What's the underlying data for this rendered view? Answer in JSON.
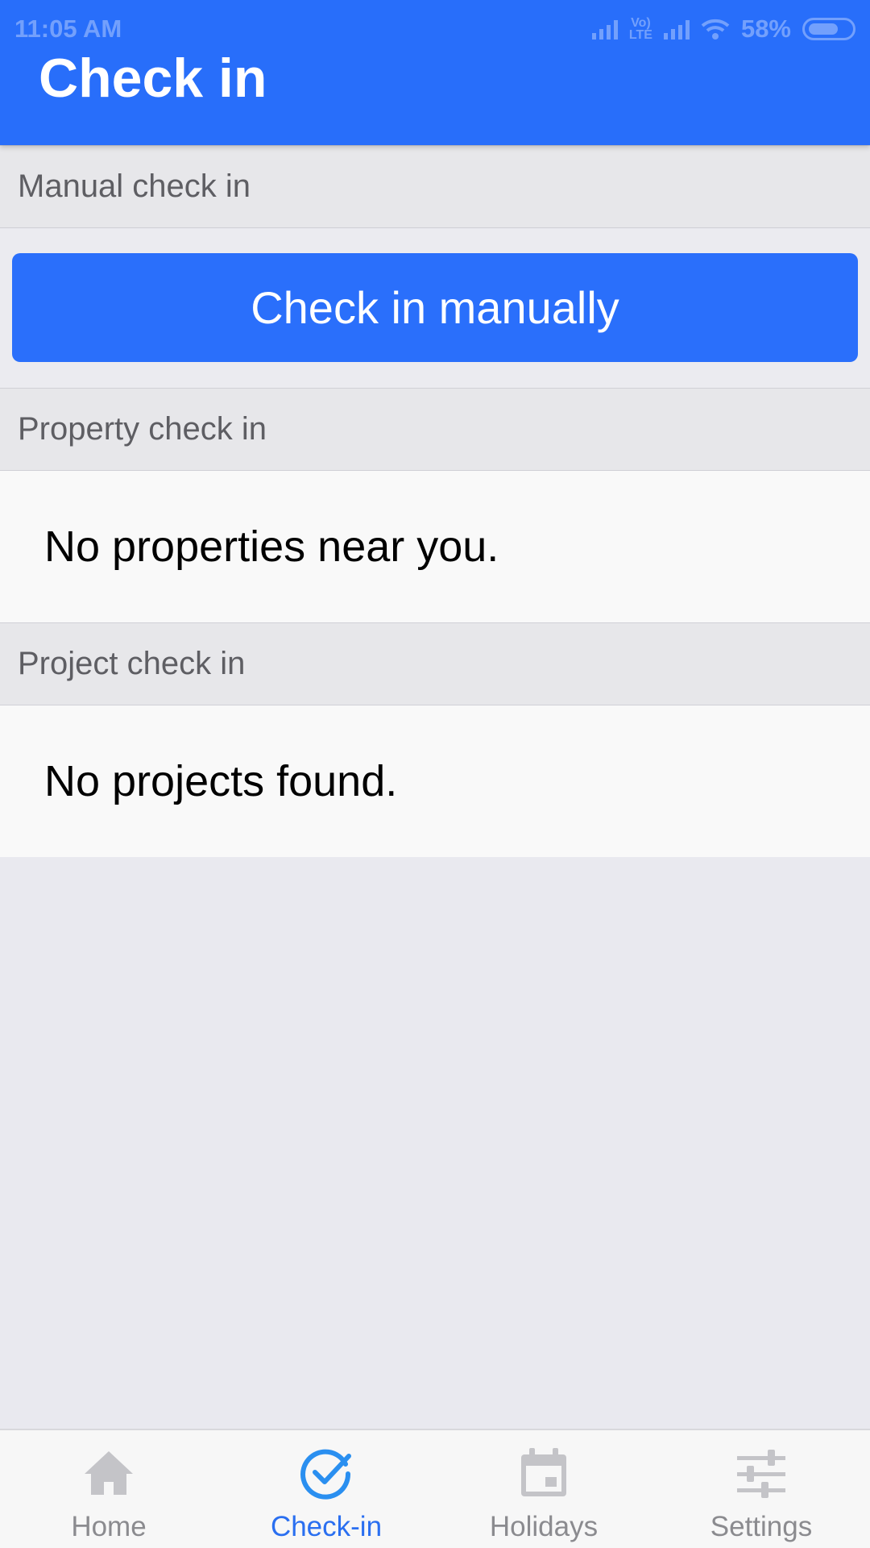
{
  "status_bar": {
    "time": "11:05 AM",
    "battery": "58%",
    "network_label": "Vo) LTE"
  },
  "header": {
    "title": "Check in"
  },
  "sections": {
    "manual": {
      "label": "Manual check in",
      "button_label": "Check in manually"
    },
    "property": {
      "label": "Property check in",
      "empty_text": "No properties near you."
    },
    "project": {
      "label": "Project check in",
      "empty_text": "No projects found."
    }
  },
  "tabs": [
    {
      "label": "Home",
      "icon": "home-icon",
      "active": false
    },
    {
      "label": "Check-in",
      "icon": "check-circle-icon",
      "active": true
    },
    {
      "label": "Holidays",
      "icon": "calendar-icon",
      "active": false
    },
    {
      "label": "Settings",
      "icon": "sliders-icon",
      "active": false
    }
  ],
  "colors": {
    "accent": "#286efa",
    "tab_active": "#2a6ff0",
    "tab_inactive": "#8b8b8f",
    "section_bg": "#e7e7ea",
    "row_bg": "#f9f9f9"
  }
}
